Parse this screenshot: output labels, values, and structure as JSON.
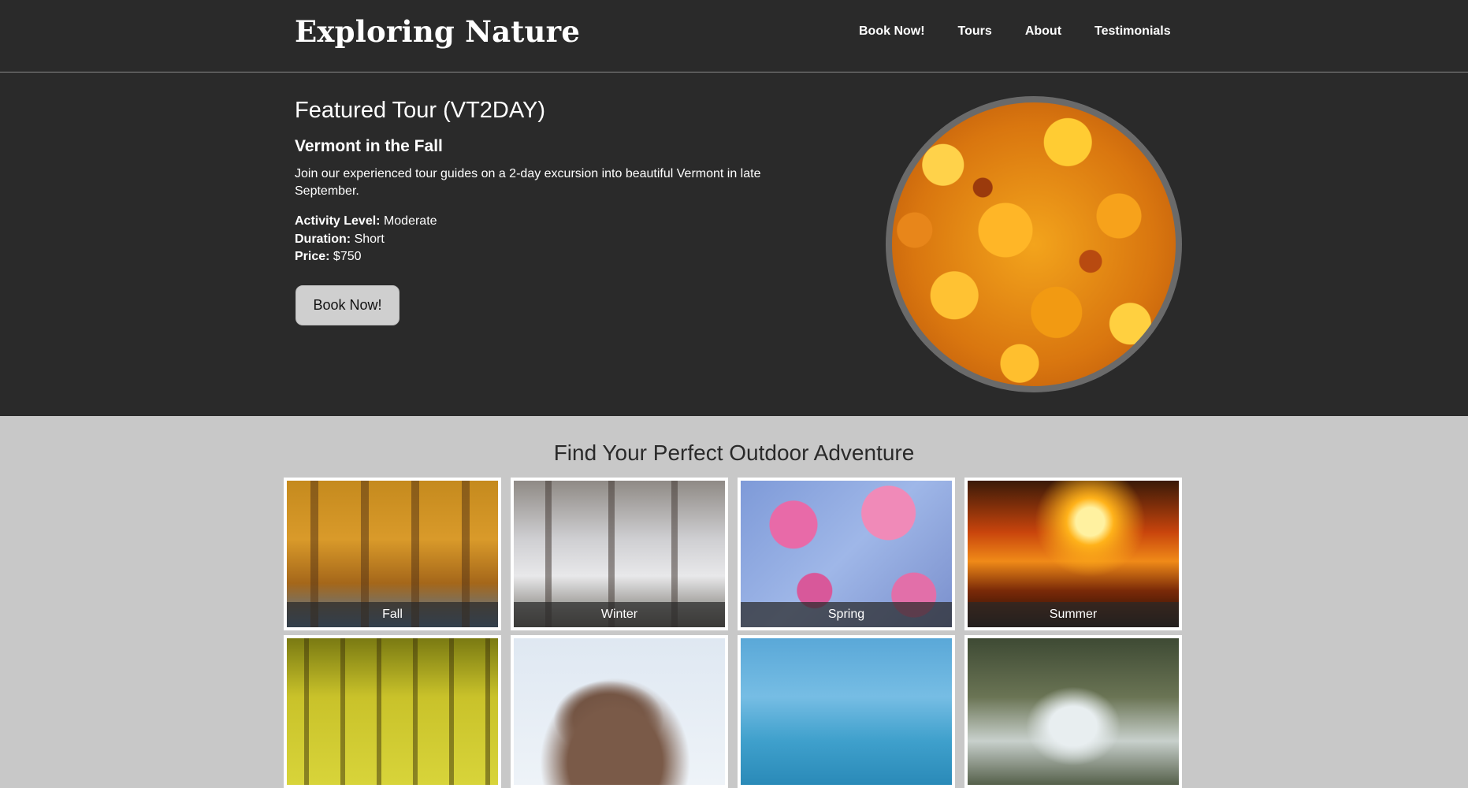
{
  "header": {
    "site_title": "Exploring Nature",
    "nav": [
      "Book Now!",
      "Tours",
      "About",
      "Testimonials"
    ]
  },
  "hero": {
    "title": "Featured Tour (VT2DAY)",
    "tour_name": "Vermont in the Fall",
    "description": "Join our experienced tour guides on a 2-day excursion into beautiful Vermont in late September.",
    "activity_label": "Activity Level:",
    "activity_value": "Moderate",
    "duration_label": "Duration:",
    "duration_value": "Short",
    "price_label": "Price:",
    "price_value": "$750",
    "book_button": "Book Now!"
  },
  "adventures": {
    "title": "Find Your Perfect Outdoor Adventure",
    "cards": [
      {
        "caption": "Fall"
      },
      {
        "caption": "Winter"
      },
      {
        "caption": "Spring"
      },
      {
        "caption": "Summer"
      },
      {
        "caption": ""
      },
      {
        "caption": ""
      },
      {
        "caption": ""
      },
      {
        "caption": ""
      }
    ]
  },
  "colors": {
    "header_bg": "#2a2a2a",
    "page_bg": "#c8c8c8",
    "button_bg": "#cfcfcf",
    "circle_border": "#6a6a6a"
  }
}
